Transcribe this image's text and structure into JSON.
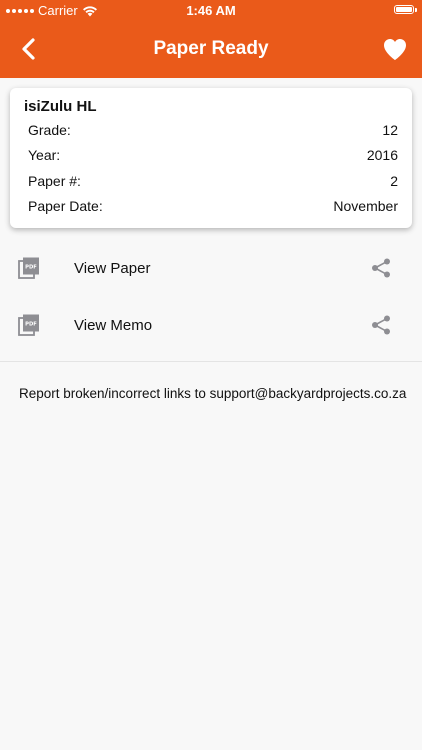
{
  "status": {
    "carrier": "Carrier",
    "time": "1:46 AM"
  },
  "nav": {
    "title": "Paper Ready"
  },
  "card": {
    "title": "isiZulu HL",
    "rows": [
      {
        "label": "Grade:",
        "value": "12"
      },
      {
        "label": "Year:",
        "value": "2016"
      },
      {
        "label": "Paper #:",
        "value": "2"
      },
      {
        "label": "Paper Date:",
        "value": "November"
      }
    ]
  },
  "actions": [
    {
      "label": "View Paper",
      "icon": "pdf-icon",
      "secondary_icon": "share-icon"
    },
    {
      "label": "View Memo",
      "icon": "pdf-icon",
      "secondary_icon": "share-icon"
    }
  ],
  "footer": {
    "report": "Report broken/incorrect links to support@backyardprojects.co.za"
  },
  "colors": {
    "accent": "#ea5a1a",
    "background": "#f8f8f8",
    "icon_gray": "#8e8e93"
  }
}
